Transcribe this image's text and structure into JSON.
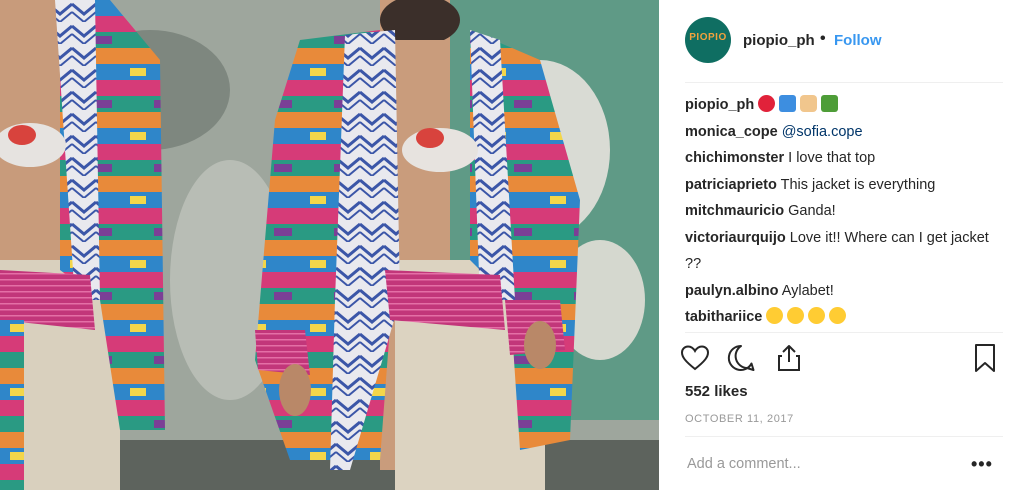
{
  "post": {
    "username": "piopio_ph",
    "separator": "•",
    "follow_label": "Follow",
    "avatar_text": "PIOPIO",
    "likes": "552 likes",
    "date": "OCTOBER 11, 2017",
    "add_comment_placeholder": "Add a comment...",
    "more_label": "•••"
  },
  "comments": [
    {
      "user": "piopio_ph",
      "text": "",
      "emojis": [
        "hibiscus-emoji",
        "wave-emoji",
        "victory-hand-emoji",
        "palm-tree-emoji"
      ]
    },
    {
      "user": "monica_cope",
      "mention": "@sofia.cope"
    },
    {
      "user": "chichimonster",
      "text": "I love that top"
    },
    {
      "user": "patriciaprieto",
      "text": "This jacket is everything"
    },
    {
      "user": "mitchmauricio",
      "text": "Ganda!"
    },
    {
      "user": "victoriaurquijo",
      "text": "Love it!! Where can I get jacket ??"
    },
    {
      "user": "paulyn.albino",
      "text": "Aylabet!"
    },
    {
      "user": "tabithariice",
      "text": "",
      "emojis": [
        "heart-eyes-emoji",
        "heart-eyes-emoji",
        "heart-eyes-emoji",
        "heart-eyes-emoji"
      ]
    }
  ],
  "icons": [
    "heart-icon",
    "comment-icon",
    "share-icon",
    "bookmark-icon"
  ],
  "colors": {
    "link": "#3897f0",
    "mention": "#003569",
    "muted": "#999999",
    "text": "#262626"
  }
}
